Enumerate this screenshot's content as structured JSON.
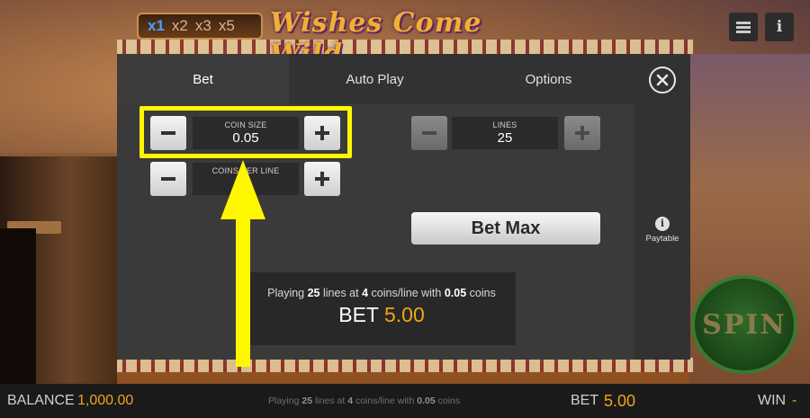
{
  "game": {
    "multipliers": [
      "x1",
      "x2",
      "x3",
      "x5"
    ],
    "logo_text": "Wishes Come Wild",
    "spin_label": "SPIN"
  },
  "modal": {
    "tabs": [
      {
        "label": "Bet",
        "active": true
      },
      {
        "label": "Auto Play",
        "active": false
      },
      {
        "label": "Options",
        "active": false
      }
    ],
    "coin_size": {
      "label": "COIN SIZE",
      "value": "0.05"
    },
    "coins_per_line": {
      "label": "COINS PER LINE",
      "value": ""
    },
    "lines": {
      "label": "LINES",
      "value": "25"
    },
    "bet_max_label": "Bet Max",
    "summary": {
      "prefix": "Playing",
      "lines": "25",
      "mid1": "lines at",
      "coins": "4",
      "mid2": "coins/line with",
      "coin_value": "0.05",
      "suffix": "coins",
      "bet_label": "BET",
      "bet_amount": "5.00"
    },
    "paytable_label": "Paytable"
  },
  "bottom_bar": {
    "balance_label": "BALANCE",
    "balance_value": "1,000.00",
    "center": {
      "prefix": "Playing",
      "lines": "25",
      "mid1": "lines at",
      "coins": "4",
      "mid2": "coins/line with",
      "coin_value": "0.05",
      "suffix": "coins"
    },
    "bet_label": "BET",
    "bet_value": "5.00",
    "win_label": "WIN",
    "win_value": "-"
  },
  "colors": {
    "accent": "#f2a518",
    "highlight": "#fff700"
  },
  "icons": [
    "menu-icon",
    "info-icon",
    "close-icon",
    "minus-icon",
    "plus-icon"
  ]
}
